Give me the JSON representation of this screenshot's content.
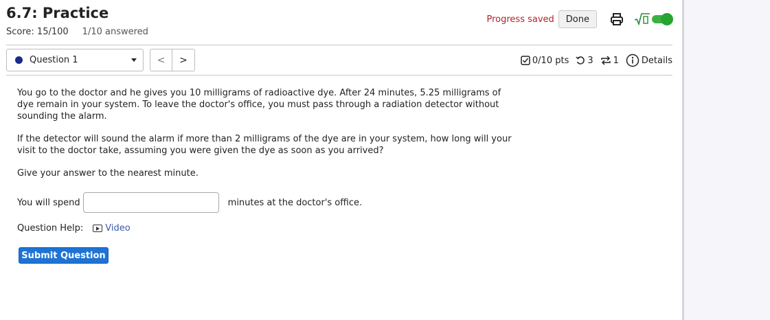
{
  "header": {
    "title": "6.7: Practice",
    "score": "Score: 15/100",
    "answered": "1/10 answered",
    "progress_saved": "Progress saved",
    "done_label": "Done",
    "icons": [
      "printer-icon",
      "sqrt-icon",
      "toggle-switch"
    ]
  },
  "question_nav": {
    "selected": "Question 1",
    "prev": "<",
    "next": ">"
  },
  "meta": {
    "points": "0/10 pts",
    "retries": "3",
    "attempts": "1",
    "details": "Details"
  },
  "question": {
    "paragraph1": "You go to the doctor and he gives you 10 milligrams of radioactive dye. After 24 minutes, 5.25 milligrams of dye remain in your system. To leave the doctor's office, you must pass through a radiation detector without sounding the alarm.",
    "paragraph2": "If the detector will sound the alarm if more than 2 milligrams of the dye are in your system, how long will your visit to the doctor take, assuming you were given the dye as soon as you arrived?",
    "paragraph3": "Give your answer to the nearest minute.",
    "answer_prefix": "You will spend",
    "answer_value": "",
    "answer_suffix": "minutes at the doctor's office.",
    "help_label": "Question Help:",
    "video_label": "Video",
    "submit_label": "Submit Question"
  },
  "colors": {
    "accent": "#1e73d4",
    "progress": "#b3222a",
    "toggle": "#3cb043",
    "link": "#3b5aa8"
  }
}
